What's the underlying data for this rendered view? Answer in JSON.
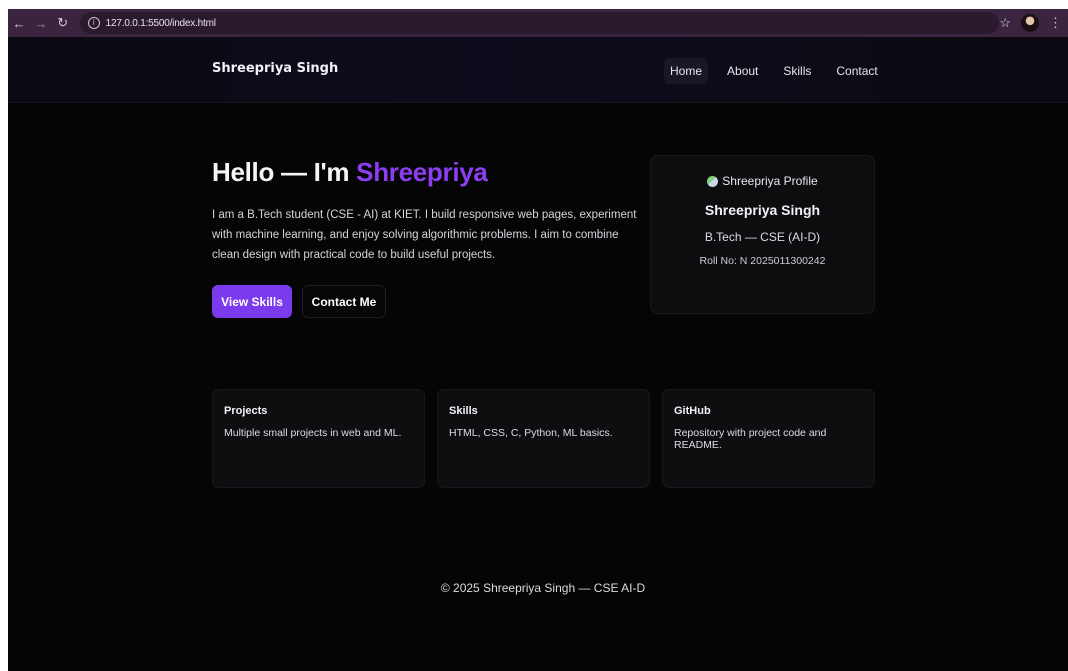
{
  "browser": {
    "url": "127.0.0.1:5500/index.html"
  },
  "header": {
    "brand": "Shreepriya Singh",
    "nav": [
      "Home",
      "About",
      "Skills",
      "Contact"
    ],
    "active": "Home"
  },
  "hero": {
    "greeting": "Hello — I'm ",
    "name_highlight": "Shreepriya",
    "intro": "I am a B.Tech student (CSE - AI) at KIET. I build responsive web pages, experiment with machine learning, and enjoy solving algorithmic problems. I aim to combine clean design with practical code to build useful projects.",
    "primary_button": "View Skills",
    "secondary_button": "Contact Me",
    "accent_color": "#7c3aed"
  },
  "profile": {
    "image_alt": "Shreepriya Profile",
    "name": "Shreepriya Singh",
    "degree": "B.Tech — CSE (AI-D)",
    "roll": "Roll No: N 2025011300242"
  },
  "cards": [
    {
      "title": "Projects",
      "text": "Multiple small projects in web and ML."
    },
    {
      "title": "Skills",
      "text": "HTML, CSS, C, Python, ML basics."
    },
    {
      "title": "GitHub",
      "text": "Repository with project code and README."
    }
  ],
  "footer": {
    "text": "© 2025 Shreepriya Singh — CSE AI-D"
  }
}
